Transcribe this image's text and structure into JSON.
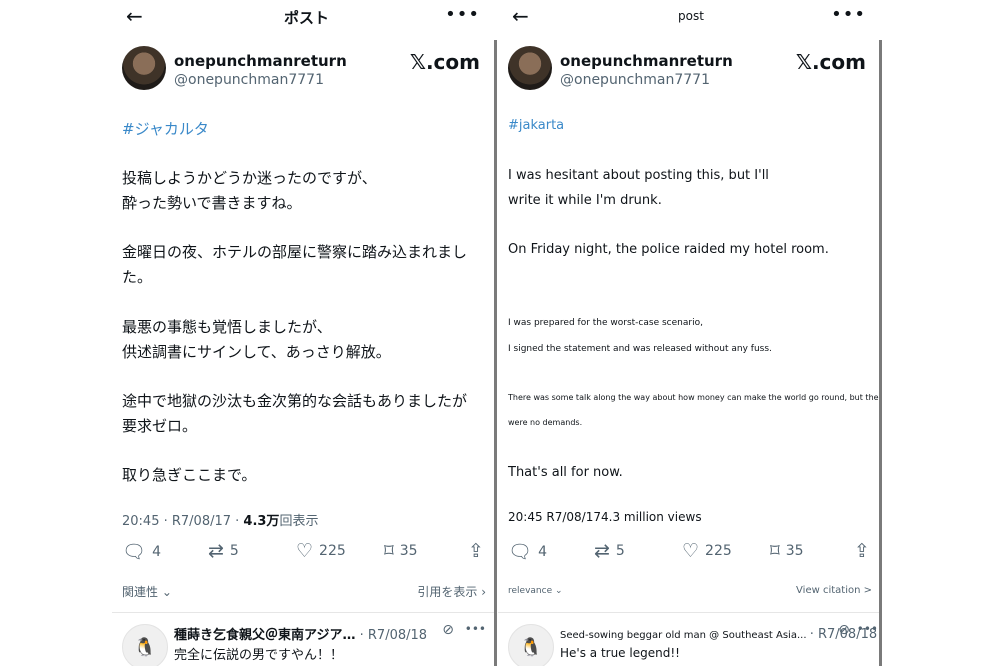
{
  "left": {
    "title": "ポスト",
    "display_name": "onepunchmanreturn",
    "handle": "@onepunchman7771",
    "site": "𝕏.com",
    "hashtag": "#ジャカルタ",
    "lines": [
      "投稿しようかどうか迷ったのですが、",
      "酔った勢いで書きますね。",
      "金曜日の夜、ホテルの部屋に警察に踏み込まれまし",
      "た。",
      "最悪の事態も覚悟しましたが、",
      "供述調書にサインして、あっさり解放。",
      "途中で地獄の沙汰も金次第的な会話もありましたが",
      "要求ゼロ。",
      "取り急ぎここまで。"
    ],
    "meta_time": "20:45 · R7/08/17 · ",
    "meta_views_num": "4.3万",
    "meta_views_label": "回表示",
    "stats": {
      "replies": "4",
      "reposts": "5",
      "likes": "225",
      "bookmarks": "35"
    },
    "relevance": "関連性",
    "citation": "引用を表示",
    "reply": {
      "name": "種蒔き乞食親父＠東南アジア…",
      "date": "· R7/08/18",
      "text": "完全に伝説の男ですやん！！"
    }
  },
  "right": {
    "title": "post",
    "display_name": "onepunchmanreturn",
    "handle": "@onepunchman7771",
    "site": "𝕏.com",
    "hashtag": "#jakarta",
    "lines": [
      "I was hesitant about posting this, but I'll",
      "write it while I'm drunk.",
      "On Friday night, the police raided my hotel room.",
      "I was prepared for the worst-case scenario,",
      "I signed the statement and was released without any fuss.",
      "There was some talk along the way about how money can make the world go round, but there",
      "were no demands.",
      "That's all for now."
    ],
    "meta": "20:45 R7/08/174.3 million views",
    "stats": {
      "replies": "4",
      "reposts": "5",
      "likes": "225",
      "bookmarks": "35"
    },
    "relevance": "relevance",
    "citation": "View citation >",
    "reply": {
      "name": "Seed-sowing beggar old man @ Southeast Asia...",
      "date": "· R7/08/18",
      "text": "He's a true legend!!"
    }
  },
  "icons": [
    "back-arrow-icon",
    "more-icon",
    "reply-icon",
    "repost-icon",
    "like-icon",
    "bookmark-icon",
    "share-icon",
    "chevron-down-icon",
    "chevron-right-icon",
    "penguin-icon",
    "grok-icon"
  ]
}
